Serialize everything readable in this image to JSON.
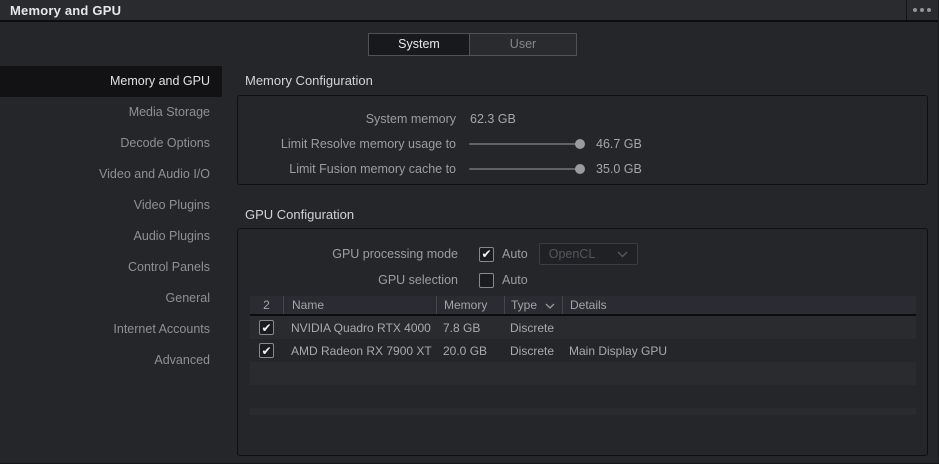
{
  "window": {
    "title": "Memory and GPU"
  },
  "tabs": {
    "system": "System",
    "user": "User"
  },
  "sidebar": {
    "items": [
      {
        "label": "Memory and GPU",
        "selected": true
      },
      {
        "label": "Media Storage",
        "selected": false
      },
      {
        "label": "Decode Options",
        "selected": false
      },
      {
        "label": "Video and Audio I/O",
        "selected": false
      },
      {
        "label": "Video Plugins",
        "selected": false
      },
      {
        "label": "Audio Plugins",
        "selected": false
      },
      {
        "label": "Control Panels",
        "selected": false
      },
      {
        "label": "General",
        "selected": false
      },
      {
        "label": "Internet Accounts",
        "selected": false
      },
      {
        "label": "Advanced",
        "selected": false
      }
    ]
  },
  "memory_config": {
    "title": "Memory Configuration",
    "system_memory_label": "System memory",
    "system_memory_value": "62.3 GB",
    "resolve_label": "Limit Resolve memory usage to",
    "resolve_value": "46.7 GB",
    "fusion_label": "Limit Fusion memory cache to",
    "fusion_value": "35.0 GB"
  },
  "gpu_config": {
    "title": "GPU Configuration",
    "processing_mode_label": "GPU processing mode",
    "processing_auto_label": "Auto",
    "processing_auto_checked": true,
    "processing_mode_value": "OpenCL",
    "selection_label": "GPU selection",
    "selection_auto_label": "Auto",
    "selection_auto_checked": false,
    "table": {
      "count_header": "2",
      "columns": {
        "name": "Name",
        "memory": "Memory",
        "type": "Type",
        "details": "Details"
      },
      "rows": [
        {
          "checked": true,
          "name": "NVIDIA Quadro RTX 4000",
          "memory": "7.8 GB",
          "type": "Discrete",
          "details": ""
        },
        {
          "checked": true,
          "name": "AMD Radeon RX 7900 XT",
          "memory": "20.0 GB",
          "type": "Discrete",
          "details": "Main Display GPU"
        }
      ]
    }
  },
  "icons": {
    "check": "✔"
  },
  "colors": {
    "background": "#25262a",
    "titlebar": "#2a2b2f",
    "selected_item_bg": "#121214",
    "panel_border": "#0e0f11",
    "table_header_bg": "#2b2c31"
  }
}
